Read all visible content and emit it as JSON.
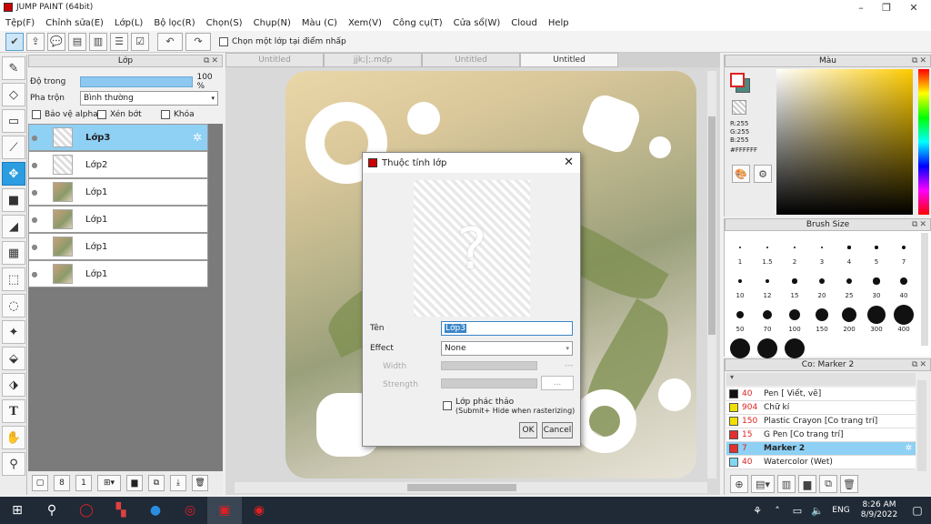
{
  "window": {
    "title": "JUMP PAINT (64bit)"
  },
  "menu": [
    "Tệp(F)",
    "Chỉnh sửa(E)",
    "Lớp(L)",
    "Bộ lọc(R)",
    "Chọn(S)",
    "Chụp(N)",
    "Màu (C)",
    "Xem(V)",
    "Công cụ(T)",
    "Cửa sổ(W)",
    "Cloud",
    "Help"
  ],
  "toolbar": {
    "pick_layer_label": "Chọn một lớp tại điểm nhấp"
  },
  "layer_panel": {
    "title": "Lớp",
    "opacity_label": "Độ trong",
    "opacity_value": "100 %",
    "opacity_fraction": 1.0,
    "blend_label": "Pha trộn",
    "blend_value": "Bình thường",
    "protect_alpha": "Bảo vệ alpha",
    "clipping": "Xén bớt",
    "lock": "Khóa",
    "layers": [
      {
        "name": "Lớp3",
        "selected": true,
        "thumb": "blank"
      },
      {
        "name": "Lớp2",
        "selected": false,
        "thumb": "blank"
      },
      {
        "name": "Lớp1",
        "selected": false,
        "thumb": "img"
      },
      {
        "name": "Lớp1",
        "selected": false,
        "thumb": "img"
      },
      {
        "name": "Lớp1",
        "selected": false,
        "thumb": "img"
      },
      {
        "name": "Lớp1",
        "selected": false,
        "thumb": "img"
      }
    ]
  },
  "canvas": {
    "tabs": [
      {
        "label": "Untitled",
        "active": false
      },
      {
        "label": "jjk;|;.mdp",
        "active": false
      },
      {
        "label": "Untitled",
        "active": false
      },
      {
        "label": "Untitled",
        "active": true
      }
    ]
  },
  "dialog": {
    "title": "Thuộc tính lớp",
    "preview_glyph": "?",
    "name_label": "Tên",
    "name_value": "Lớp3",
    "effect_label": "Effect",
    "effect_value": "None",
    "width_label": "Width",
    "width_value": "---",
    "strength_label": "Strength",
    "strength_btn": "...",
    "draft_label": "Lớp phác thảo",
    "draft_note": "(Submit+ Hide when rasterizing)",
    "ok": "OK",
    "cancel": "Cancel"
  },
  "color_panel": {
    "title": "Màu",
    "r": "R:255",
    "g": "G:255",
    "b": "B:255",
    "hex": "#FFFFFF",
    "fg_color": "#ffffff",
    "bg_color": "#4a8a80"
  },
  "brush_panel": {
    "title": "Brush Size",
    "sizes": [
      "1",
      "1.5",
      "2",
      "3",
      "4",
      "5",
      "7",
      "10",
      "12",
      "15",
      "20",
      "25",
      "30",
      "40",
      "50",
      "70",
      "100",
      "150",
      "200",
      "300",
      "400",
      "",
      "",
      ""
    ]
  },
  "marker_panel": {
    "title": "Co: Marker 2",
    "items": [
      {
        "num": "40",
        "name": "Pen [ Viết, vẽ]",
        "color": "#111111",
        "selected": false
      },
      {
        "num": "904",
        "name": "Chữ kí",
        "color": "#f0e000",
        "selected": false
      },
      {
        "num": "150",
        "name": "Plastic Crayon [Co trang trí]",
        "color": "#f0e000",
        "selected": false
      },
      {
        "num": "15",
        "name": "G Pen [Co trang trí]",
        "color": "#e03030",
        "selected": false
      },
      {
        "num": "7",
        "name": "Marker 2",
        "color": "#e03030",
        "selected": true
      },
      {
        "num": "40",
        "name": "Watercolor (Wet)",
        "color": "#7fd8f0",
        "selected": false
      }
    ]
  },
  "taskbar": {
    "lang": "ENG",
    "time": "8:26 AM",
    "date": "8/9/2022"
  }
}
